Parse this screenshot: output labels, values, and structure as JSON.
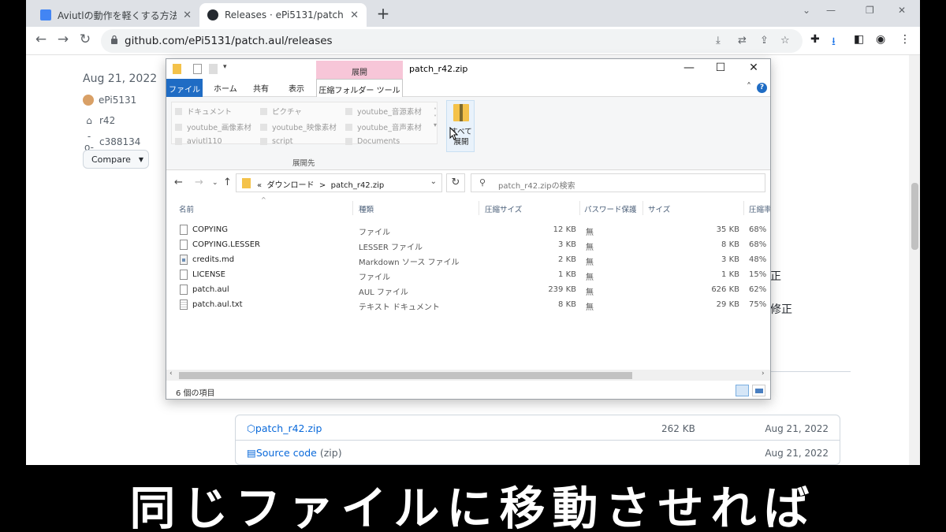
{
  "browser": {
    "tabs": [
      {
        "title": "Aviutlの動作を軽くする方法○選 - ",
        "active": false
      },
      {
        "title": "Releases · ePi5131/patch.aul",
        "active": true
      }
    ],
    "new_tab": "+",
    "url": "github.com/ePi5131/patch.aul/releases",
    "accent": "#1a73e8"
  },
  "github": {
    "date": "Aug 21, 2022",
    "author": "ePi5131",
    "tag": "r42",
    "commit": "c388134",
    "compare_label": "Compare",
    "bg_texts": [
      "正",
      "修正"
    ],
    "assets": [
      {
        "name": "patch_r42.zip",
        "size": "262 KB",
        "date": "Aug 21, 2022"
      },
      {
        "name": "Source code",
        "suffix": "(zip)",
        "size": "",
        "date": "Aug 21, 2022"
      }
    ]
  },
  "explorer": {
    "title": "patch_r42.zip",
    "context_tab_header": "展開",
    "ribbon_tabs": {
      "file": "ファイル",
      "home": "ホーム",
      "share": "共有",
      "view": "表示",
      "context": "圧縮フォルダー ツール"
    },
    "destinations": [
      "ドキュメント",
      "ピクチャ",
      "youtube_音源素材",
      "youtube_画像素材",
      "youtube_映像素材",
      "youtube_音声素材",
      "aviutl110",
      "script",
      "Documents"
    ],
    "destinations_label": "展開先",
    "extract_all_label": "すべて展開",
    "address": {
      "root": "«",
      "folder": "ダウンロード",
      "sep": ">",
      "current": "patch_r42.zip"
    },
    "search_placeholder": "patch_r42.zipの検索",
    "columns": [
      "名前",
      "種類",
      "圧縮サイズ",
      "パスワード保護",
      "サイズ",
      "圧縮率"
    ],
    "files": [
      {
        "name": "COPYING",
        "type": "ファイル",
        "compressed": "12 KB",
        "password": "無",
        "size": "35 KB",
        "ratio": "68%",
        "icon": "file"
      },
      {
        "name": "COPYING.LESSER",
        "type": "LESSER ファイル",
        "compressed": "3 KB",
        "password": "無",
        "size": "8 KB",
        "ratio": "68%",
        "icon": "file"
      },
      {
        "name": "credits.md",
        "type": "Markdown ソース ファイル",
        "compressed": "2 KB",
        "password": "無",
        "size": "3 KB",
        "ratio": "48%",
        "icon": "md"
      },
      {
        "name": "LICENSE",
        "type": "ファイル",
        "compressed": "1 KB",
        "password": "無",
        "size": "1 KB",
        "ratio": "15%",
        "icon": "file"
      },
      {
        "name": "patch.aul",
        "type": "AUL ファイル",
        "compressed": "239 KB",
        "password": "無",
        "size": "626 KB",
        "ratio": "62%",
        "icon": "file"
      },
      {
        "name": "patch.aul.txt",
        "type": "テキスト ドキュメント",
        "compressed": "8 KB",
        "password": "無",
        "size": "29 KB",
        "ratio": "75%",
        "icon": "txt"
      }
    ],
    "status_count": "6 個の項目"
  },
  "caption": {
    "text": "同じファイルに移動させれば"
  }
}
